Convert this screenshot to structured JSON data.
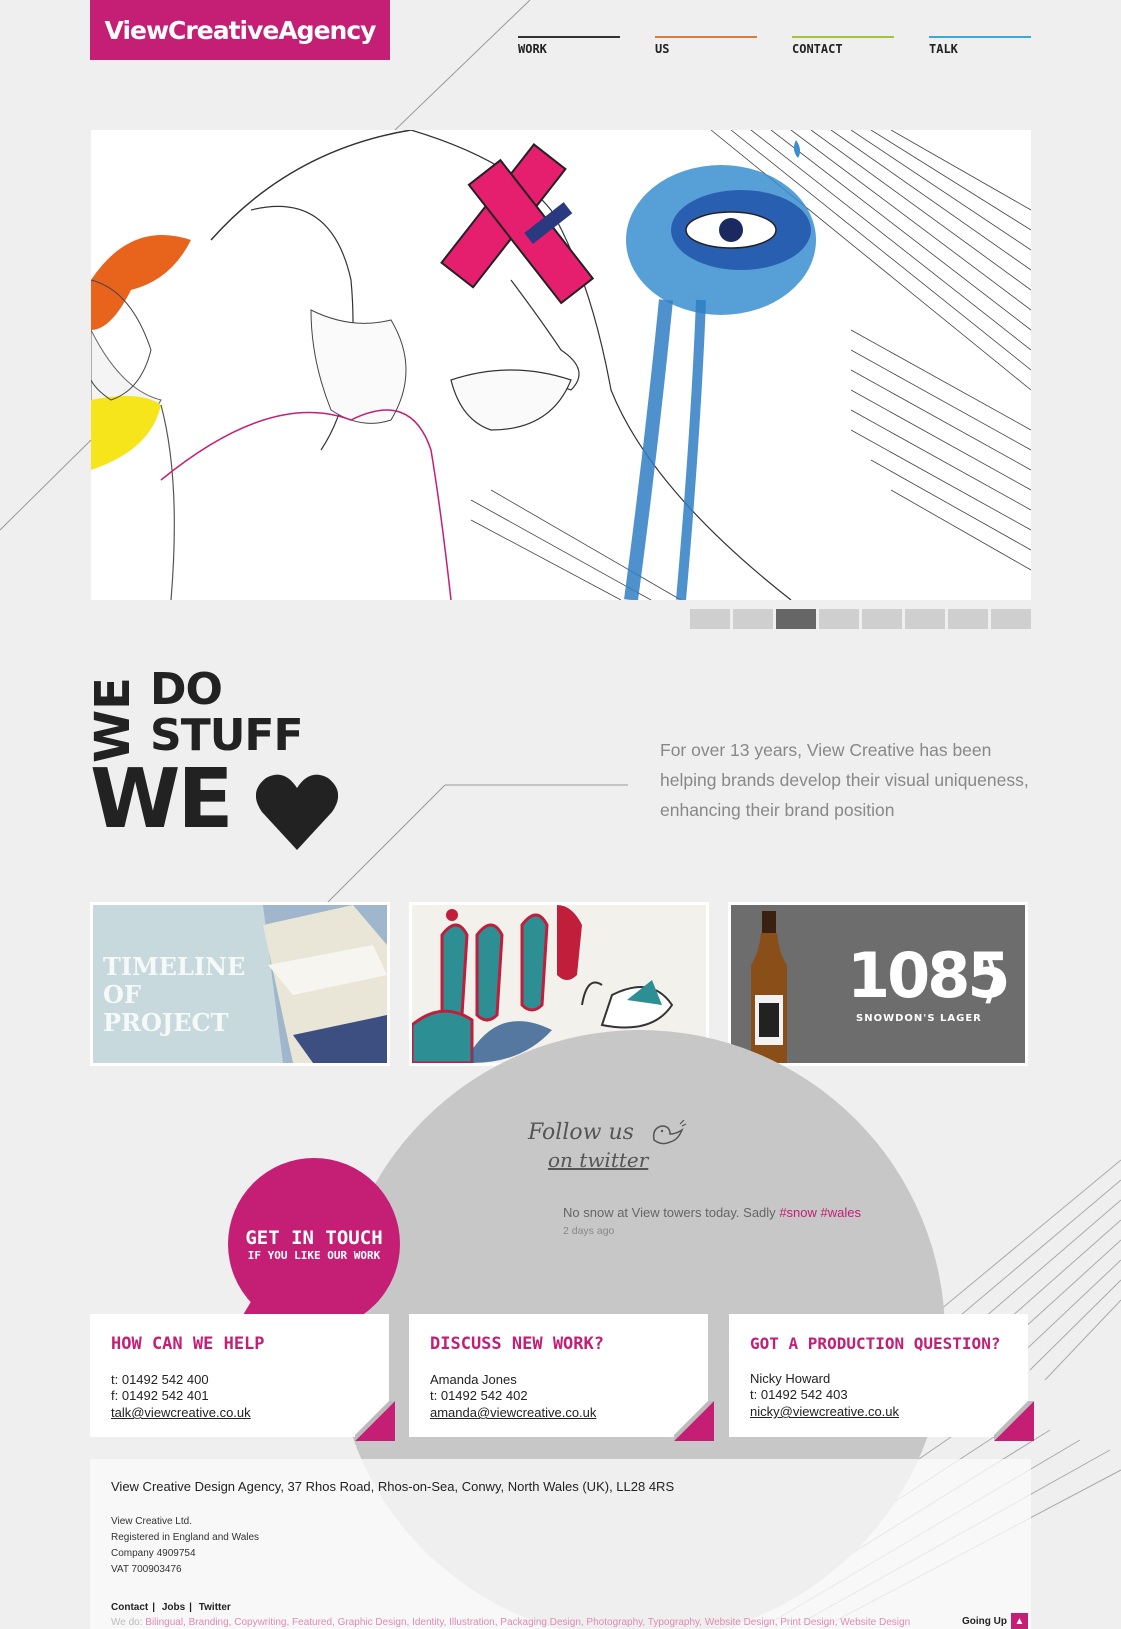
{
  "logo": {
    "text": "ViewCreativeAgency"
  },
  "nav": [
    {
      "label": "Work",
      "color": "#222222"
    },
    {
      "label": "Us",
      "color": "#e07a3c"
    },
    {
      "label": "Contact",
      "color": "#a9c23c"
    },
    {
      "label": "Talk",
      "color": "#3ca9d9"
    }
  ],
  "slider": {
    "count": 8,
    "active_index": 2
  },
  "tagline": {
    "line1_a": "WE",
    "line1_b": "DO",
    "line2": "STUFF",
    "line3": "WE",
    "heart_icon": "heart-icon"
  },
  "intro": "For over 13 years, View Creative has been helping brands develop their visual uniqueness, enhancing their brand position",
  "thumbs": [
    {
      "name": "thumb-timeline-project",
      "text": "TIMELINE OF PROJECT"
    },
    {
      "name": "thumb-typography",
      "text": ""
    },
    {
      "name": "thumb-1085-lager",
      "text": "1085",
      "sub": "SNOWDON'S LAGER"
    }
  ],
  "twitter": {
    "follow_line1": "Follow us",
    "follow_line2": "on twitter",
    "tweet_text": "No snow at View towers today. Sadly",
    "tag1": "#snow",
    "tag2": "#wales",
    "time": "2 days ago"
  },
  "get_in_touch": {
    "big": "GET IN TOUCH",
    "small": "IF YOU LIKE OUR WORK"
  },
  "cards": [
    {
      "title": "How can we help",
      "line1": "t: 01492 542 400",
      "line2": "f: 01492 542 401",
      "email": "talk@viewcreative.co.uk"
    },
    {
      "title": "Discuss new work?",
      "line1": "Amanda Jones",
      "line2": "t: 01492 542 402",
      "email": "amanda@viewcreative.co.uk"
    },
    {
      "title": "Got a production question?",
      "line1": "Nicky Howard",
      "line2": "t: 01492 542 403",
      "email": "nicky@viewcreative.co.uk"
    }
  ],
  "footer": {
    "address": "View Creative Design Agency, 37 Rhos Road, Rhos-on-Sea, Conwy, North Wales (UK), LL28 4RS",
    "legal1": "View Creative Ltd.",
    "legal2": "Registered in England and Wales",
    "legal3": "Company 4909754",
    "legal4": "VAT 700903476",
    "links": [
      "Contact",
      "Jobs",
      "Twitter"
    ],
    "wedo_label": "We do:",
    "wedo_items": "Bilingual, Branding, Copywriting, Featured, Graphic Design, Identity, Illustration, Packaging Design, Photography, Typography, Website Design, Print Design, Website Design",
    "going_up": "Going Up"
  },
  "colors": {
    "accent": "#c41e75",
    "background": "#efefef"
  }
}
